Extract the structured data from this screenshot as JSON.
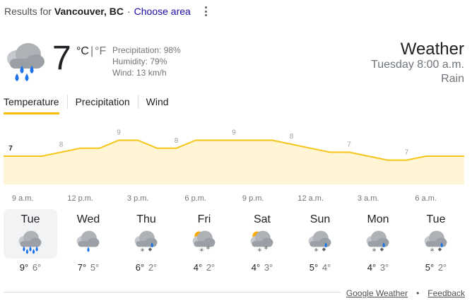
{
  "header": {
    "results_prefix": "Results for",
    "location": "Vancouver, BC",
    "separator": "·",
    "choose_area": "Choose area",
    "more_icon": "more-vert-icon"
  },
  "current": {
    "icon": "rain-icon",
    "temperature": "7",
    "unit_c": "°C",
    "unit_sep": "|",
    "unit_f": "°F",
    "precipitation": "Precipitation: 98%",
    "humidity": "Humidity: 79%",
    "wind": "Wind: 13 km/h"
  },
  "summary": {
    "title": "Weather",
    "time": "Tuesday 8:00 a.m.",
    "condition": "Rain"
  },
  "tabs": [
    {
      "label": "Temperature",
      "active": true
    },
    {
      "label": "Precipitation",
      "active": false
    },
    {
      "label": "Wind",
      "active": false
    }
  ],
  "colors": {
    "accent": "#fbbc04",
    "chart_fill": "#fff5d4",
    "chart_line": "#f5c518",
    "rain_drop": "#1a73e8",
    "cloud": "#9aa0a6",
    "sun": "#f9ab00"
  },
  "chart_data": {
    "type": "area",
    "x": [
      "8 a.m.",
      "9 a.m.",
      "10 a.m.",
      "11 a.m.",
      "12 p.m.",
      "1 p.m.",
      "2 p.m.",
      "3 p.m.",
      "4 p.m.",
      "5 p.m.",
      "6 p.m.",
      "7 p.m.",
      "8 p.m.",
      "9 p.m.",
      "10 p.m.",
      "11 p.m.",
      "12 a.m.",
      "1 a.m.",
      "2 a.m.",
      "3 a.m.",
      "4 a.m.",
      "5 a.m.",
      "6 a.m.",
      "7 a.m.",
      "8 a.m."
    ],
    "values": [
      7,
      7,
      7,
      7.5,
      8,
      8,
      9,
      9,
      8,
      8,
      9,
      9,
      9,
      9,
      9,
      8.5,
      8,
      7.5,
      7.5,
      7,
      6.5,
      6.5,
      7,
      7,
      7
    ],
    "labels": [
      {
        "index": 0,
        "text": "7",
        "current": true
      },
      {
        "index": 3,
        "text": "8"
      },
      {
        "index": 6,
        "text": "9"
      },
      {
        "index": 9,
        "text": "8"
      },
      {
        "index": 12,
        "text": "9"
      },
      {
        "index": 15,
        "text": "8"
      },
      {
        "index": 18,
        "text": "7"
      },
      {
        "index": 21,
        "text": "7"
      }
    ],
    "time_ticks": [
      "9 a.m.",
      "12 p.m.",
      "3 p.m.",
      "6 p.m.",
      "9 p.m.",
      "12 a.m.",
      "3 a.m.",
      "6 a.m."
    ],
    "ylim": [
      3,
      11
    ],
    "grid": false
  },
  "forecast": [
    {
      "day": "Tue",
      "icon": "heavy-rain-icon",
      "high": "9°",
      "low": "6°",
      "selected": true
    },
    {
      "day": "Wed",
      "icon": "cloud-rain-icon",
      "high": "7°",
      "low": "5°",
      "selected": false
    },
    {
      "day": "Thu",
      "icon": "rain-snow-icon",
      "high": "6°",
      "low": "2°",
      "selected": false
    },
    {
      "day": "Fri",
      "icon": "sun-cloud-snow-icon",
      "high": "4°",
      "low": "2°",
      "selected": false
    },
    {
      "day": "Sat",
      "icon": "sun-cloud-snow-icon",
      "high": "4°",
      "low": "3°",
      "selected": false
    },
    {
      "day": "Sun",
      "icon": "rain-snow-icon",
      "high": "5°",
      "low": "4°",
      "selected": false
    },
    {
      "day": "Mon",
      "icon": "rain-snow-icon",
      "high": "4°",
      "low": "3°",
      "selected": false
    },
    {
      "day": "Tue",
      "icon": "rain-snow-icon",
      "high": "5°",
      "low": "2°",
      "selected": false
    }
  ],
  "footer": {
    "source_link": "Google Weather",
    "dot": "•",
    "feedback_link": "Feedback"
  }
}
